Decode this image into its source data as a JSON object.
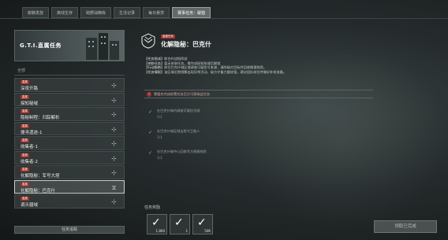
{
  "tabs": [
    "薪酬发放",
    "离线生存",
    "跨野战精练",
    "生活记录",
    "每日悬赏",
    "赛事任务：破猎"
  ],
  "active_tab_index": 5,
  "banner": {
    "title": "G.T.I.直属任务"
  },
  "filter": {
    "label": "全部"
  },
  "missions": [
    {
      "tag": "直属",
      "title": "深夜开路",
      "icon": "compass-icon"
    },
    {
      "tag": "直属",
      "title": "探知秘域",
      "icon": "compass-icon"
    },
    {
      "tag": "直属",
      "title": "隐秘制程：归踪解析",
      "icon": "compass-icon"
    },
    {
      "tag": "直属",
      "title": "搜寻遗迹-1",
      "icon": "compass-icon"
    },
    {
      "tag": "直属",
      "title": "收集者-1",
      "icon": "compass-icon"
    },
    {
      "tag": "直属",
      "title": "收集者-2",
      "icon": "compass-icon"
    },
    {
      "tag": "直属",
      "title": "化解隐秘：军号大塔",
      "icon": "compass-icon"
    },
    {
      "tag": "直属",
      "title": "化解隐秘：巴克什",
      "icon": "tracking-icon",
      "selected": true
    },
    {
      "tag": "直属",
      "title": "调天疆域",
      "icon": "compass-icon"
    }
  ],
  "track_button": "任务追踪",
  "detail": {
    "tag": "直属任务",
    "title": "化解隐秘：巴克什",
    "info": [
      {
        "k": "【任务指派】",
        "v": "联合作战指挥部"
      },
      {
        "k": "【关联任务】",
        "v": "暂无关联任务，需完成探知秘域后解锁"
      },
      {
        "k": "【行动指南】",
        "v": "前往巴克什城区域调查可疑信号来源，清除敌对目标并回收情报物资。"
      },
      {
        "k": "【任务情报】",
        "v": "该区域近期频繁出现异常活动，敌方守备力量较强，建议组队前往并做好补给准备。"
      }
    ],
    "warning": "需要先完成前置任务后方可接取此任务",
    "objectives": [
      {
        "text": "在巴克什城内调查可疑信号源",
        "progress": "1/1"
      },
      {
        "text": "在巴克什城区域击败守卫敌人",
        "progress": "1/1"
      },
      {
        "text": "在巴克什城中心回收军方情报物资",
        "progress": "1/1"
      }
    ],
    "reward_label": "任务奖励",
    "rewards": [
      {
        "qty": "1,800"
      },
      {
        "qty": "1"
      },
      {
        "qty": "50K"
      }
    ],
    "claim_button": "领取已完成"
  }
}
